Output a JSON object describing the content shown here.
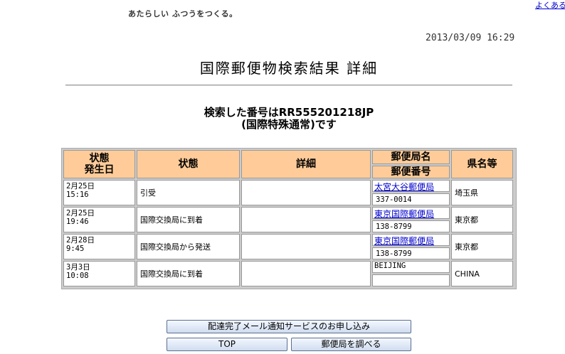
{
  "header": {
    "tagline": "あたらしい ふつうをつくる。",
    "faq_link": "よくある"
  },
  "datetime": "2013/03/09 16:29",
  "page_title": "国際郵便物検索結果 詳細",
  "search": {
    "line1": "検索した番号はRR555201218JP",
    "line2": "(国際特殊通常)です"
  },
  "table": {
    "headers": {
      "date_line1": "状態",
      "date_line2": "発生日",
      "status": "状態",
      "detail": "詳細",
      "office_name": "郵便局名",
      "postal_code": "郵便番号",
      "prefecture": "県名等"
    },
    "rows": [
      {
        "date": "2月25日",
        "time": "15:16",
        "status": "引受",
        "detail": "",
        "office": "太宮大谷郵便局",
        "office_link": true,
        "postal": "337-0014",
        "pref": "埼玉県"
      },
      {
        "date": "2月25日",
        "time": "19:46",
        "status": "国際交換局に到着",
        "detail": "",
        "office": "東京国際郵便局",
        "office_link": true,
        "postal": "138-8799",
        "pref": "東京都"
      },
      {
        "date": "2月28日",
        "time": "9:45",
        "status": "国際交換局から発送",
        "detail": "",
        "office": "東京国際郵便局",
        "office_link": true,
        "postal": "138-8799",
        "pref": "東京都"
      },
      {
        "date": "3月3日",
        "time": "10:08",
        "status": "国際交換局に到着",
        "detail": "",
        "office": "BEIJING",
        "office_link": false,
        "postal": "",
        "pref": "CHINA"
      }
    ]
  },
  "buttons": {
    "mail_notify": "配達完了メール通知サービスのお申し込み",
    "top": "TOP",
    "find_office": "郵便局を調べる"
  }
}
